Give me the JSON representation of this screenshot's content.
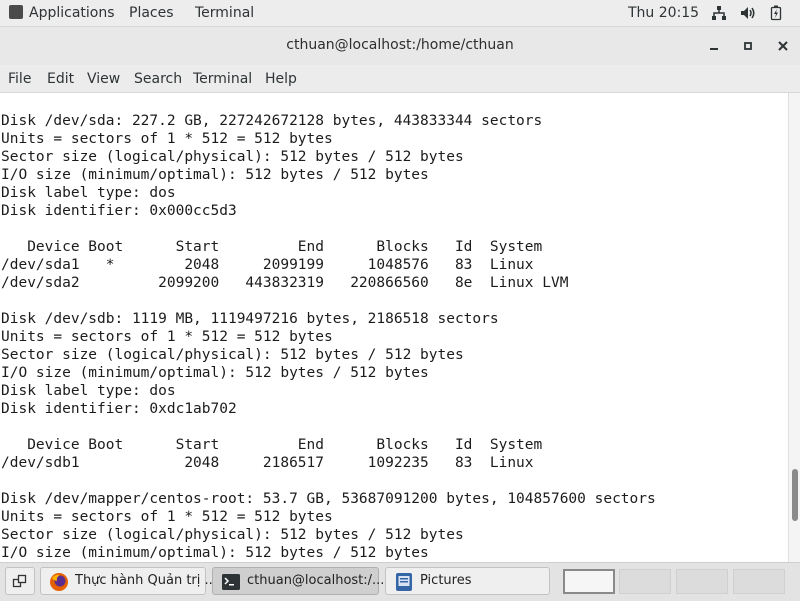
{
  "top_panel": {
    "applications_label": "Applications",
    "places_label": "Places",
    "terminal_label": "Terminal",
    "clock": "Thu 20:15",
    "tray_icons": [
      "network-icon",
      "volume-icon",
      "battery-icon"
    ]
  },
  "window": {
    "title": "cthuan@localhost:/home/cthuan",
    "controls": [
      "minimize-icon",
      "maximize-icon",
      "close-icon"
    ]
  },
  "menu": {
    "file": "File",
    "edit": "Edit",
    "view": "View",
    "search": "Search",
    "terminal": "Terminal",
    "help": "Help"
  },
  "terminal": {
    "lines": [
      "Disk /dev/sda: 227.2 GB, 227242672128 bytes, 443833344 sectors",
      "Units = sectors of 1 * 512 = 512 bytes",
      "Sector size (logical/physical): 512 bytes / 512 bytes",
      "I/O size (minimum/optimal): 512 bytes / 512 bytes",
      "Disk label type: dos",
      "Disk identifier: 0x000cc5d3",
      "",
      "   Device Boot      Start         End      Blocks   Id  System",
      "/dev/sda1   *        2048     2099199     1048576   83  Linux",
      "/dev/sda2         2099200   443832319   220866560   8e  Linux LVM",
      "",
      "Disk /dev/sdb: 1119 MB, 1119497216 bytes, 2186518 sectors",
      "Units = sectors of 1 * 512 = 512 bytes",
      "Sector size (logical/physical): 512 bytes / 512 bytes",
      "I/O size (minimum/optimal): 512 bytes / 512 bytes",
      "Disk label type: dos",
      "Disk identifier: 0xdc1ab702",
      "",
      "   Device Boot      Start         End      Blocks   Id  System",
      "/dev/sdb1            2048     2186517     1092235   83  Linux",
      "",
      "Disk /dev/mapper/centos-root: 53.7 GB, 53687091200 bytes, 104857600 sectors",
      "Units = sectors of 1 * 512 = 512 bytes",
      "Sector size (logical/physical): 512 bytes / 512 bytes",
      "I/O size (minimum/optimal): 512 bytes / 512 bytes"
    ]
  },
  "taskbar": {
    "show_desktop_icon": "show-desktop-icon",
    "tasks": [
      {
        "label": "Thực hành Quản trị ...",
        "icon": "firefox-icon"
      },
      {
        "label": "cthuan@localhost:/...",
        "icon": "terminal-icon"
      },
      {
        "label": "Pictures",
        "icon": "file-manager-icon"
      }
    ],
    "workspaces": 4
  },
  "colors": {
    "panel_bg": "#ededed",
    "terminal_bg": "#ffffff",
    "terminal_fg": "#1c1c1c",
    "firefox_orange": "#e66000"
  }
}
